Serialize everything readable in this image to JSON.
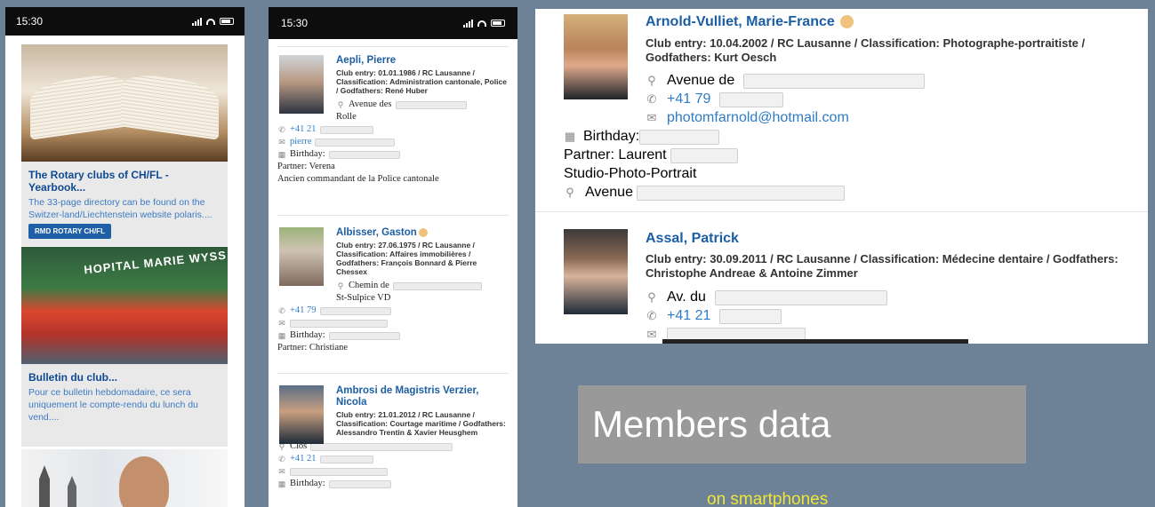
{
  "phone1": {
    "time": "15:30",
    "cards": [
      {
        "title": "The Rotary clubs of CH/FL - Yearbook...",
        "text": "The 33-page directory can be found on the Switzer-land/Liechtenstein website polaris....",
        "button": "RMD ROTARY CH/FL"
      },
      {
        "title": "Bulletin du club...",
        "text": "Pour ce bulletin hebdomadaire, ce sera uniquement le compte-rendu du lunch du vend....",
        "banner": "HOPITAL MARIE WYSS"
      }
    ]
  },
  "phone2": {
    "time": "15:30",
    "members": [
      {
        "name": "Aepli, Pierre",
        "meta": "Club entry: 01.01.1986 / RC Lausanne / Classification: Administration cantonale, Police / Godfathers: René Huber",
        "address": "Avenue des",
        "city": "Rolle",
        "phone": "+41 21",
        "email": "pierre",
        "birthday": "Birthday:",
        "partner": "Partner: Verena",
        "note": "Ancien commandant de la Police cantonale"
      },
      {
        "name": "Albisser, Gaston",
        "meta": "Club entry: 27.06.1975 / RC Lausanne / Classification: Affaires immobilières / Godfathers: François Bonnard & Pierre Chessex",
        "address": "Chemin de",
        "city": "St-Sulpice VD",
        "phone": "+41 79",
        "birthday": "Birthday:",
        "partner": "Partner: Christiane"
      },
      {
        "name": "Ambrosi de Magistris Verzier, Nicola",
        "meta": "Club entry: 21.01.2012 / RC Lausanne / Classification: Courtage maritime / Godfathers: Alessandro Trentin & Xavier Heusghem",
        "address": "Clos",
        "phone": "+41 21",
        "birthday": "Birthday:"
      }
    ]
  },
  "panel": {
    "members": [
      {
        "name": "Arnold-Vulliet, Marie-France",
        "meta": "Club entry: 10.04.2002  /  RC Lausanne  /  Classification: Photographe-portraitiste  /  Godfathers: Kurt Oesch",
        "address": "Avenue de",
        "phone": "+41 79",
        "email": "photomfarnold@hotmail.com",
        "birthday": "Birthday:",
        "partner": "Partner: Laurent",
        "business": "Studio-Photo-Portrait",
        "business_address": "Avenue"
      },
      {
        "name": "Assal, Patrick",
        "meta": "Club entry: 30.09.2011  /  RC Lausanne  /  Classification: Médecine dentaire  /  Godfathers: Christophe Andreae & Antoine Zimmer",
        "address": "Av. du",
        "phone": "+41 21"
      }
    ]
  },
  "caption": {
    "title": "Members data",
    "subtitle": "on smartphones"
  }
}
